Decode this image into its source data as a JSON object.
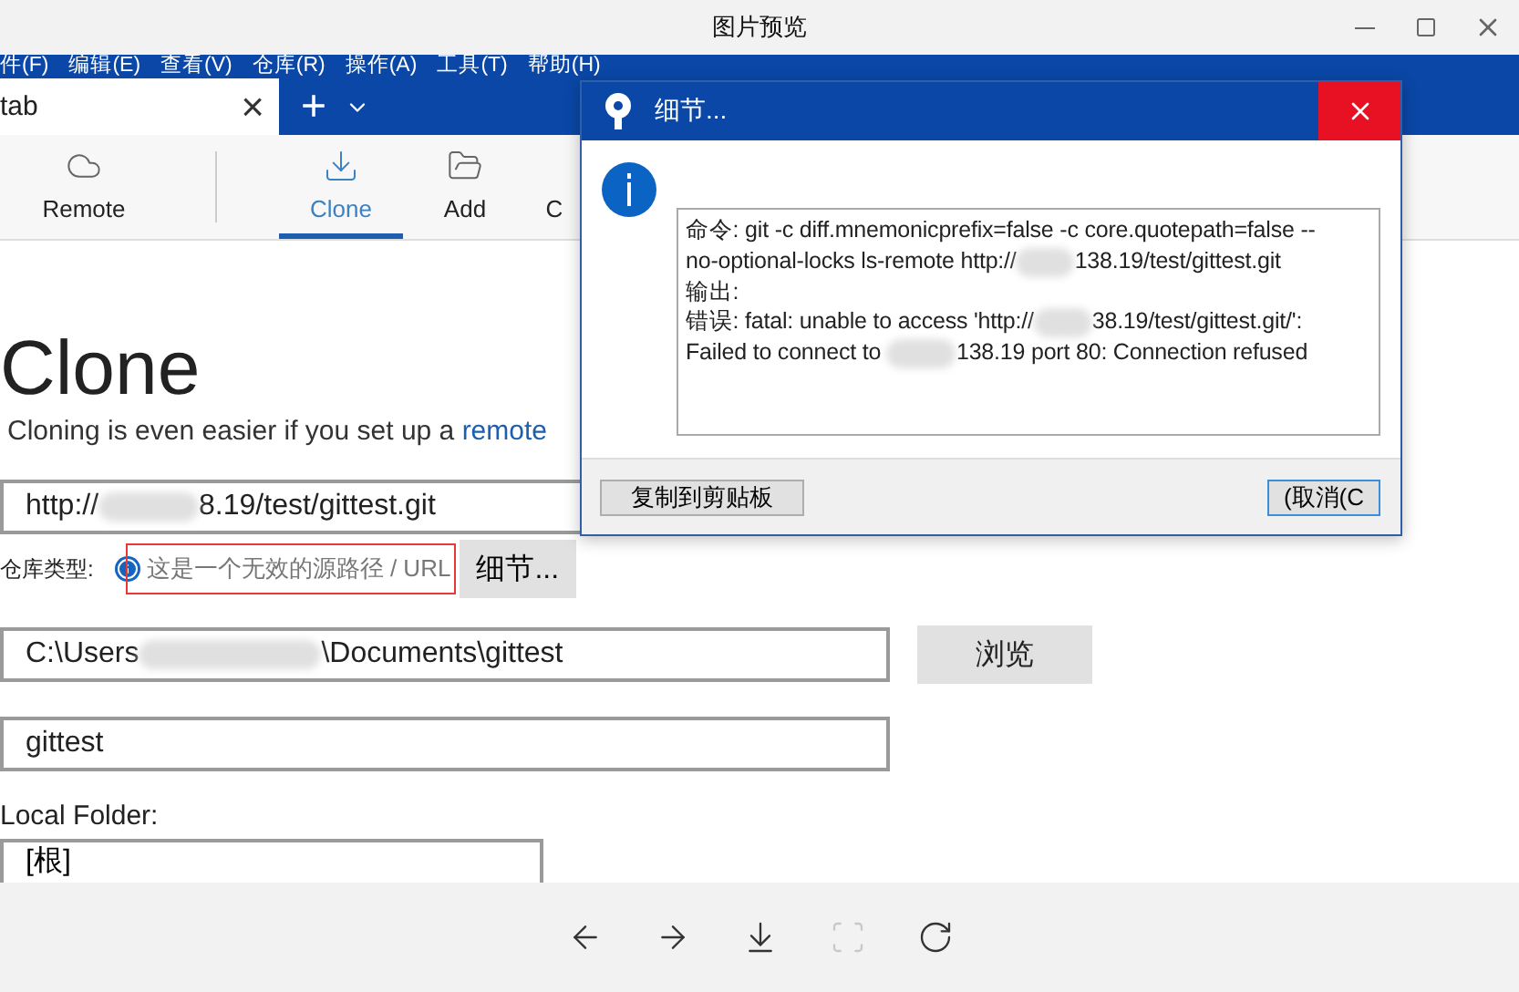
{
  "viewer": {
    "title": "图片预览"
  },
  "menu": [
    "件(F)",
    "编辑(E)",
    "查看(V)",
    "仓库(R)",
    "操作(A)",
    "工具(T)",
    "帮助(H)"
  ],
  "tab": {
    "label": "tab",
    "close": "×",
    "add": "+"
  },
  "toolbar": [
    {
      "kind": "remote",
      "label": "Remote",
      "selected": false
    },
    {
      "kind": "clone",
      "label": "Clone",
      "selected": true
    },
    {
      "kind": "add",
      "label": "Add",
      "selected": false
    },
    {
      "kind": "other",
      "label": "C"
    }
  ],
  "clone": {
    "heading": "Clone",
    "subtitle": "Cloning is even easier if you set up a ",
    "subtitle_link": "remote",
    "url_parts": [
      "http://",
      "8.19/test/gittest.git"
    ],
    "repo_type_label": "仓库类型:",
    "error_message": "这是一个无效的源路径 / URL",
    "details_button": "细节...",
    "path_parts": [
      "C:\\Users",
      "\\Documents\\gittest"
    ],
    "browse_button": "浏览",
    "name_value": "gittest",
    "local_folder_label": "Local Folder:",
    "local_folder_value": "[根]"
  },
  "dialog": {
    "title": "细节...",
    "lines": [
      [
        "命令: git -c diff.mnemonicprefix=false -c core.quotepath=false --"
      ],
      [
        "no-optional-locks ls-remote http://",
        "138.19/test/gittest.git"
      ],
      [
        "输出:"
      ],
      [
        "错误: fatal: unable to access 'http://",
        "38.19/test/gittest.git/':"
      ],
      [
        "Failed to connect to ",
        "138.19 port 80: Connection refused"
      ]
    ],
    "copy_button": "复制到剪贴板",
    "cancel_button": "(取消(C"
  },
  "bottom_bar": [
    {
      "kind": "back",
      "disabled": false
    },
    {
      "kind": "forward",
      "disabled": false
    },
    {
      "kind": "save",
      "disabled": false
    },
    {
      "kind": "crop",
      "disabled": true
    },
    {
      "kind": "rotate",
      "disabled": false
    }
  ]
}
